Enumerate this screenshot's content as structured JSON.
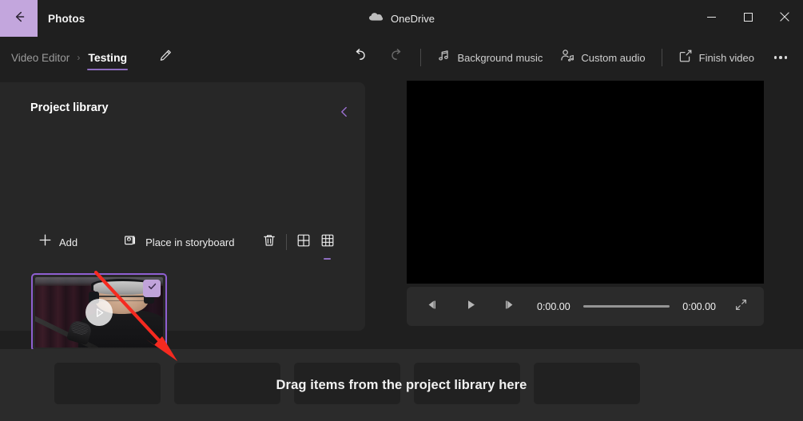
{
  "titlebar": {
    "back_icon": "back-arrow-icon",
    "app_title": "Photos",
    "cloud_icon": "onedrive-cloud-icon",
    "onedrive_label": "OneDrive",
    "minimize_label": "Minimize",
    "maximize_label": "Maximize",
    "close_label": "Close"
  },
  "breadcrumb": {
    "root": "Video Editor",
    "separator": "›",
    "current": "Testing",
    "rename_icon": "pencil-icon"
  },
  "commandbar": {
    "undo_icon": "undo-icon",
    "redo_icon": "redo-icon",
    "undo_enabled": "true",
    "redo_enabled": "false",
    "items": [
      {
        "label": "Background music",
        "icon": "music-note-icon"
      },
      {
        "label": "Custom audio",
        "icon": "person-audio-icon"
      },
      {
        "label": "Finish video",
        "icon": "export-share-icon"
      }
    ],
    "more_icon": "more-ellipsis-icon"
  },
  "library": {
    "title": "Project library",
    "collapse_icon": "chevron-left-icon",
    "add_label": "Add",
    "add_icon": "plus-icon",
    "place_label": "Place in storyboard",
    "place_icon": "place-in-storyboard-icon",
    "delete_icon": "trash-icon",
    "view_large_icon": "grid-2x2-icon",
    "view_small_icon": "grid-3x3-icon",
    "active_view": "grid-3x3-icon",
    "items": [
      {
        "name": "video-thumbnail",
        "selected": "true",
        "play_icon": "play-circle-icon",
        "check_icon": "checkmark-icon"
      }
    ]
  },
  "preview": {
    "previous_frame_icon": "previous-frame-icon",
    "play_icon": "play-icon",
    "next_frame_icon": "next-frame-icon",
    "current_time": "0:00.00",
    "total_time": "0:00.00",
    "fullscreen_icon": "expand-fullscreen-icon",
    "progress_percent": 0
  },
  "storyboard": {
    "hint": "Drag items from the project library here",
    "slot_count": 5
  },
  "annotation": {
    "arrow_color": "#f52a20",
    "arrow_name": "red-arrow-annotation"
  },
  "colors": {
    "accent_purple": "#8e6dc0",
    "back_button_purple": "#c3a6dd",
    "selection_purple": "#8f5fd1",
    "window_bg": "#1f1f1f",
    "panel_bg": "#272727",
    "storyboard_bg": "#2b2b2b"
  }
}
